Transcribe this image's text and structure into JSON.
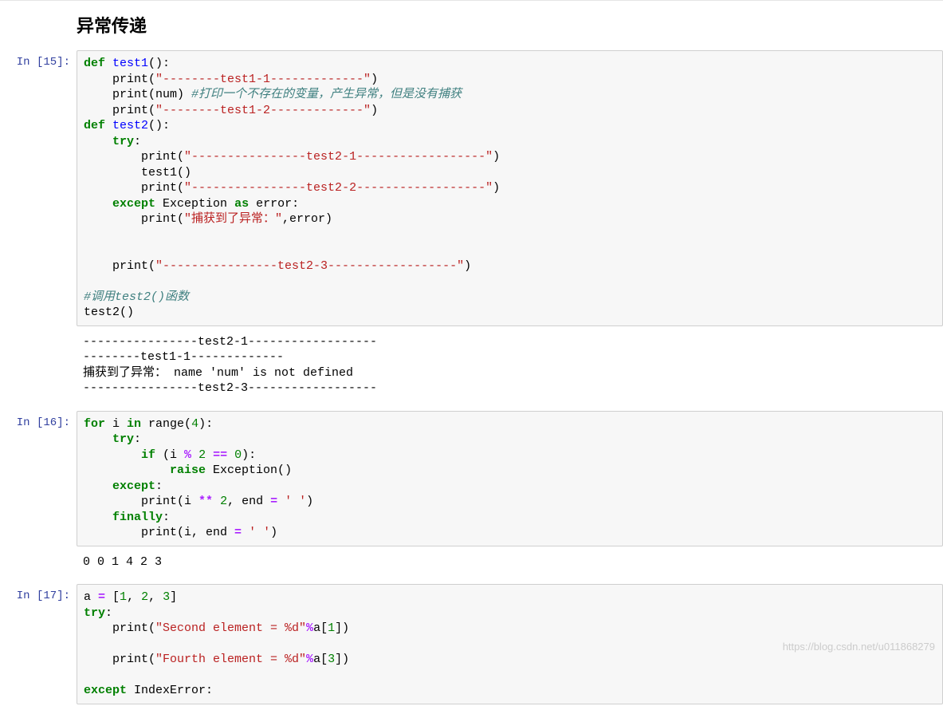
{
  "heading": "异常传递",
  "watermark": "https://blog.csdn.net/u011868279",
  "cells": [
    {
      "prompt": "In  [15]:",
      "lines": [
        [
          {
            "cls": "kw",
            "t": "def"
          },
          {
            "cls": "",
            "t": " "
          },
          {
            "cls": "fn",
            "t": "test1"
          },
          {
            "cls": "",
            "t": "():"
          }
        ],
        [
          {
            "cls": "",
            "t": "    print("
          },
          {
            "cls": "str",
            "t": "\"--------test1-1-------------\""
          },
          {
            "cls": "",
            "t": ")"
          }
        ],
        [
          {
            "cls": "",
            "t": "    print(num) "
          },
          {
            "cls": "cmt",
            "t": "#打印一个不存在的变量，产生异常，但是没有捕获"
          }
        ],
        [
          {
            "cls": "",
            "t": "    print("
          },
          {
            "cls": "str",
            "t": "\"--------test1-2-------------\""
          },
          {
            "cls": "",
            "t": ")"
          }
        ],
        [
          {
            "cls": "kw",
            "t": "def"
          },
          {
            "cls": "",
            "t": " "
          },
          {
            "cls": "fn",
            "t": "test2"
          },
          {
            "cls": "",
            "t": "():"
          }
        ],
        [
          {
            "cls": "",
            "t": "    "
          },
          {
            "cls": "kw",
            "t": "try"
          },
          {
            "cls": "",
            "t": ":"
          }
        ],
        [
          {
            "cls": "",
            "t": "        print("
          },
          {
            "cls": "str",
            "t": "\"----------------test2-1------------------\""
          },
          {
            "cls": "",
            "t": ")"
          }
        ],
        [
          {
            "cls": "",
            "t": "        test1()"
          }
        ],
        [
          {
            "cls": "",
            "t": "        print("
          },
          {
            "cls": "str",
            "t": "\"----------------test2-2------------------\""
          },
          {
            "cls": "",
            "t": ")"
          }
        ],
        [
          {
            "cls": "",
            "t": "    "
          },
          {
            "cls": "kw",
            "t": "except"
          },
          {
            "cls": "",
            "t": " Exception "
          },
          {
            "cls": "kw",
            "t": "as"
          },
          {
            "cls": "",
            "t": " error:"
          }
        ],
        [
          {
            "cls": "",
            "t": "        print("
          },
          {
            "cls": "str",
            "t": "\"捕获到了异常：\""
          },
          {
            "cls": "",
            "t": ",error)"
          }
        ],
        [
          {
            "cls": "",
            "t": ""
          }
        ],
        [
          {
            "cls": "",
            "t": ""
          }
        ],
        [
          {
            "cls": "",
            "t": "    print("
          },
          {
            "cls": "str",
            "t": "\"----------------test2-3------------------\""
          },
          {
            "cls": "",
            "t": ")"
          }
        ],
        [
          {
            "cls": "",
            "t": ""
          }
        ],
        [
          {
            "cls": "cmt",
            "t": "#调用test2()函数"
          }
        ],
        [
          {
            "cls": "",
            "t": "test2()"
          }
        ]
      ],
      "output": "----------------test2-1------------------\n--------test1-1-------------\n捕获到了异常： name 'num' is not defined\n----------------test2-3------------------"
    },
    {
      "prompt": "In  [16]:",
      "lines": [
        [
          {
            "cls": "kw",
            "t": "for"
          },
          {
            "cls": "",
            "t": " i "
          },
          {
            "cls": "kw",
            "t": "in"
          },
          {
            "cls": "",
            "t": " range("
          },
          {
            "cls": "num",
            "t": "4"
          },
          {
            "cls": "",
            "t": "):"
          }
        ],
        [
          {
            "cls": "",
            "t": "    "
          },
          {
            "cls": "kw",
            "t": "try"
          },
          {
            "cls": "",
            "t": ":"
          }
        ],
        [
          {
            "cls": "",
            "t": "        "
          },
          {
            "cls": "kw",
            "t": "if"
          },
          {
            "cls": "",
            "t": " (i "
          },
          {
            "cls": "op",
            "t": "%"
          },
          {
            "cls": "",
            "t": " "
          },
          {
            "cls": "num",
            "t": "2"
          },
          {
            "cls": "",
            "t": " "
          },
          {
            "cls": "op",
            "t": "=="
          },
          {
            "cls": "",
            "t": " "
          },
          {
            "cls": "num",
            "t": "0"
          },
          {
            "cls": "",
            "t": "):"
          }
        ],
        [
          {
            "cls": "",
            "t": "            "
          },
          {
            "cls": "kw",
            "t": "raise"
          },
          {
            "cls": "",
            "t": " Exception()"
          }
        ],
        [
          {
            "cls": "",
            "t": "    "
          },
          {
            "cls": "kw",
            "t": "except"
          },
          {
            "cls": "",
            "t": ":"
          }
        ],
        [
          {
            "cls": "",
            "t": "        print(i "
          },
          {
            "cls": "op",
            "t": "**"
          },
          {
            "cls": "",
            "t": " "
          },
          {
            "cls": "num",
            "t": "2"
          },
          {
            "cls": "",
            "t": ", end "
          },
          {
            "cls": "op",
            "t": "="
          },
          {
            "cls": "",
            "t": " "
          },
          {
            "cls": "str",
            "t": "' '"
          },
          {
            "cls": "",
            "t": ")"
          }
        ],
        [
          {
            "cls": "",
            "t": "    "
          },
          {
            "cls": "kw",
            "t": "finally"
          },
          {
            "cls": "",
            "t": ":"
          }
        ],
        [
          {
            "cls": "",
            "t": "        print(i, end "
          },
          {
            "cls": "op",
            "t": "="
          },
          {
            "cls": "",
            "t": " "
          },
          {
            "cls": "str",
            "t": "' '"
          },
          {
            "cls": "",
            "t": ")"
          }
        ]
      ],
      "output": "0 0 1 4 2 3 "
    },
    {
      "prompt": "In  [17]:",
      "lines": [
        [
          {
            "cls": "",
            "t": "a "
          },
          {
            "cls": "op",
            "t": "="
          },
          {
            "cls": "",
            "t": " ["
          },
          {
            "cls": "num",
            "t": "1"
          },
          {
            "cls": "",
            "t": ", "
          },
          {
            "cls": "num",
            "t": "2"
          },
          {
            "cls": "",
            "t": ", "
          },
          {
            "cls": "num",
            "t": "3"
          },
          {
            "cls": "",
            "t": "]"
          }
        ],
        [
          {
            "cls": "kw",
            "t": "try"
          },
          {
            "cls": "",
            "t": ":"
          }
        ],
        [
          {
            "cls": "",
            "t": "    print("
          },
          {
            "cls": "str",
            "t": "\"Second element = %d\""
          },
          {
            "cls": "op",
            "t": "%"
          },
          {
            "cls": "",
            "t": "a["
          },
          {
            "cls": "num",
            "t": "1"
          },
          {
            "cls": "",
            "t": "])"
          }
        ],
        [
          {
            "cls": "",
            "t": ""
          }
        ],
        [
          {
            "cls": "",
            "t": "    print("
          },
          {
            "cls": "str",
            "t": "\"Fourth element = %d\""
          },
          {
            "cls": "op",
            "t": "%"
          },
          {
            "cls": "",
            "t": "a["
          },
          {
            "cls": "num",
            "t": "3"
          },
          {
            "cls": "",
            "t": "])"
          }
        ],
        [
          {
            "cls": "",
            "t": ""
          }
        ],
        [
          {
            "cls": "kw",
            "t": "except"
          },
          {
            "cls": "",
            "t": " IndexError:"
          }
        ]
      ],
      "output": null
    }
  ]
}
